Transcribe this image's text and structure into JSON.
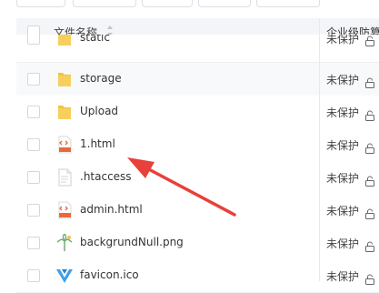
{
  "table": {
    "header": {
      "name_label": "文件名称",
      "protect_label": "企业级防篡"
    },
    "rows": [
      {
        "name": "static",
        "type": "folder",
        "status": "未保护"
      },
      {
        "name": "storage",
        "type": "folder",
        "status": "未保护"
      },
      {
        "name": "Upload",
        "type": "folder",
        "status": "未保护"
      },
      {
        "name": "1.html",
        "type": "html",
        "status": "未保护"
      },
      {
        "name": ".htaccess",
        "type": "file",
        "status": "未保护"
      },
      {
        "name": "admin.html",
        "type": "html",
        "status": "未保护"
      },
      {
        "name": "backgrundNull.png",
        "type": "image",
        "status": "未保护"
      },
      {
        "name": "favicon.ico",
        "type": "ico",
        "status": "未保护"
      }
    ]
  },
  "colors": {
    "accent_arrow": "#e8403a",
    "folder": "#f5c242",
    "html_icon": "#e86a3a"
  },
  "icons": {
    "folder": "folder-icon",
    "html": "html-file-icon",
    "file": "generic-file-icon",
    "image": "image-file-icon",
    "ico": "vue-ico-icon",
    "lock": "unlock-icon",
    "sort": "sort-icon"
  }
}
